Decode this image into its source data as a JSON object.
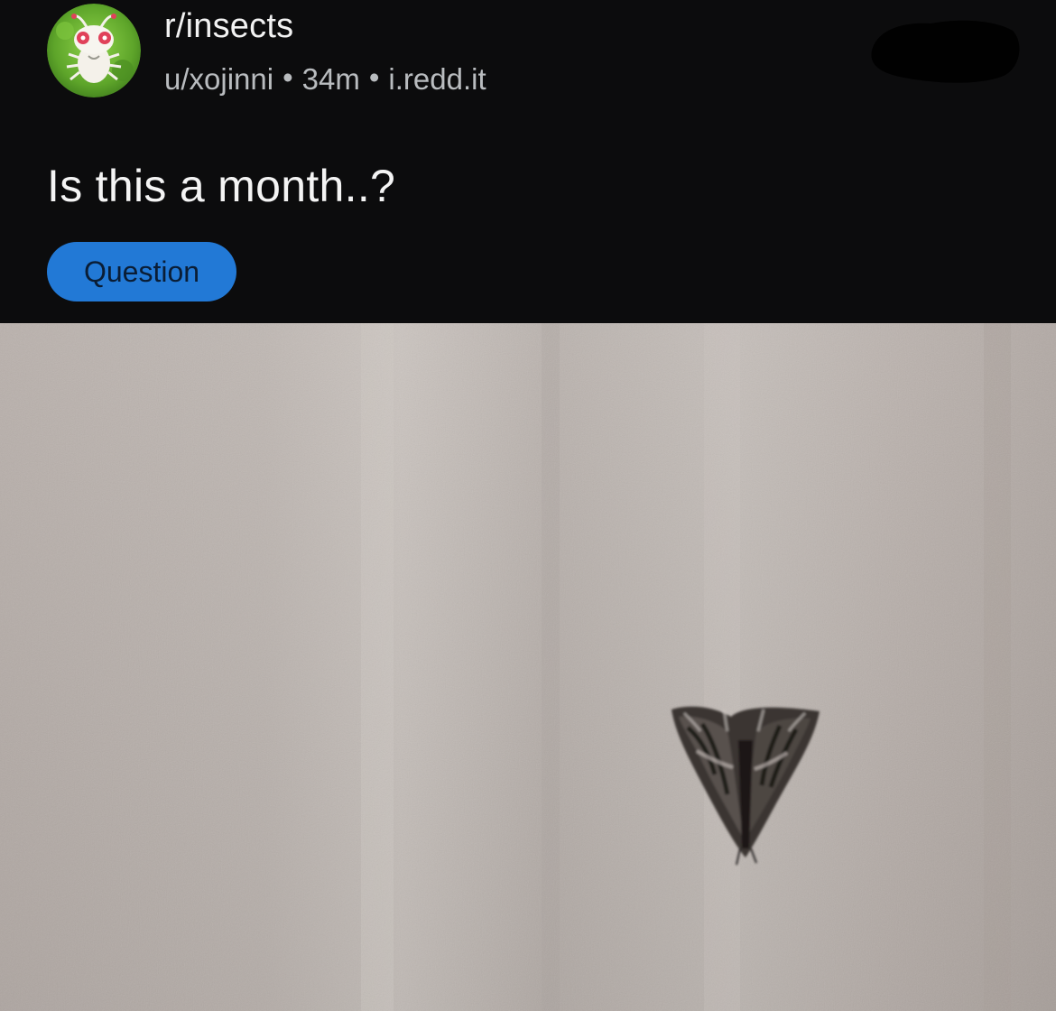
{
  "post": {
    "community": "r/insects",
    "author": "u/xojinni",
    "age": "34m",
    "domain": "i.redd.it",
    "separator": "•",
    "title": "Is this a month..?",
    "flair": "Question"
  },
  "icons": {
    "community_avatar": "snoo-bug-avatar-icon",
    "redaction": "redacted-blob"
  },
  "colors": {
    "background": "#0c0c0d",
    "title": "#f4f4f4",
    "meta": "#b9bcbf",
    "flair": "#2279d6",
    "photo_wall": "#bab1ab",
    "moth": "#2a2625"
  }
}
